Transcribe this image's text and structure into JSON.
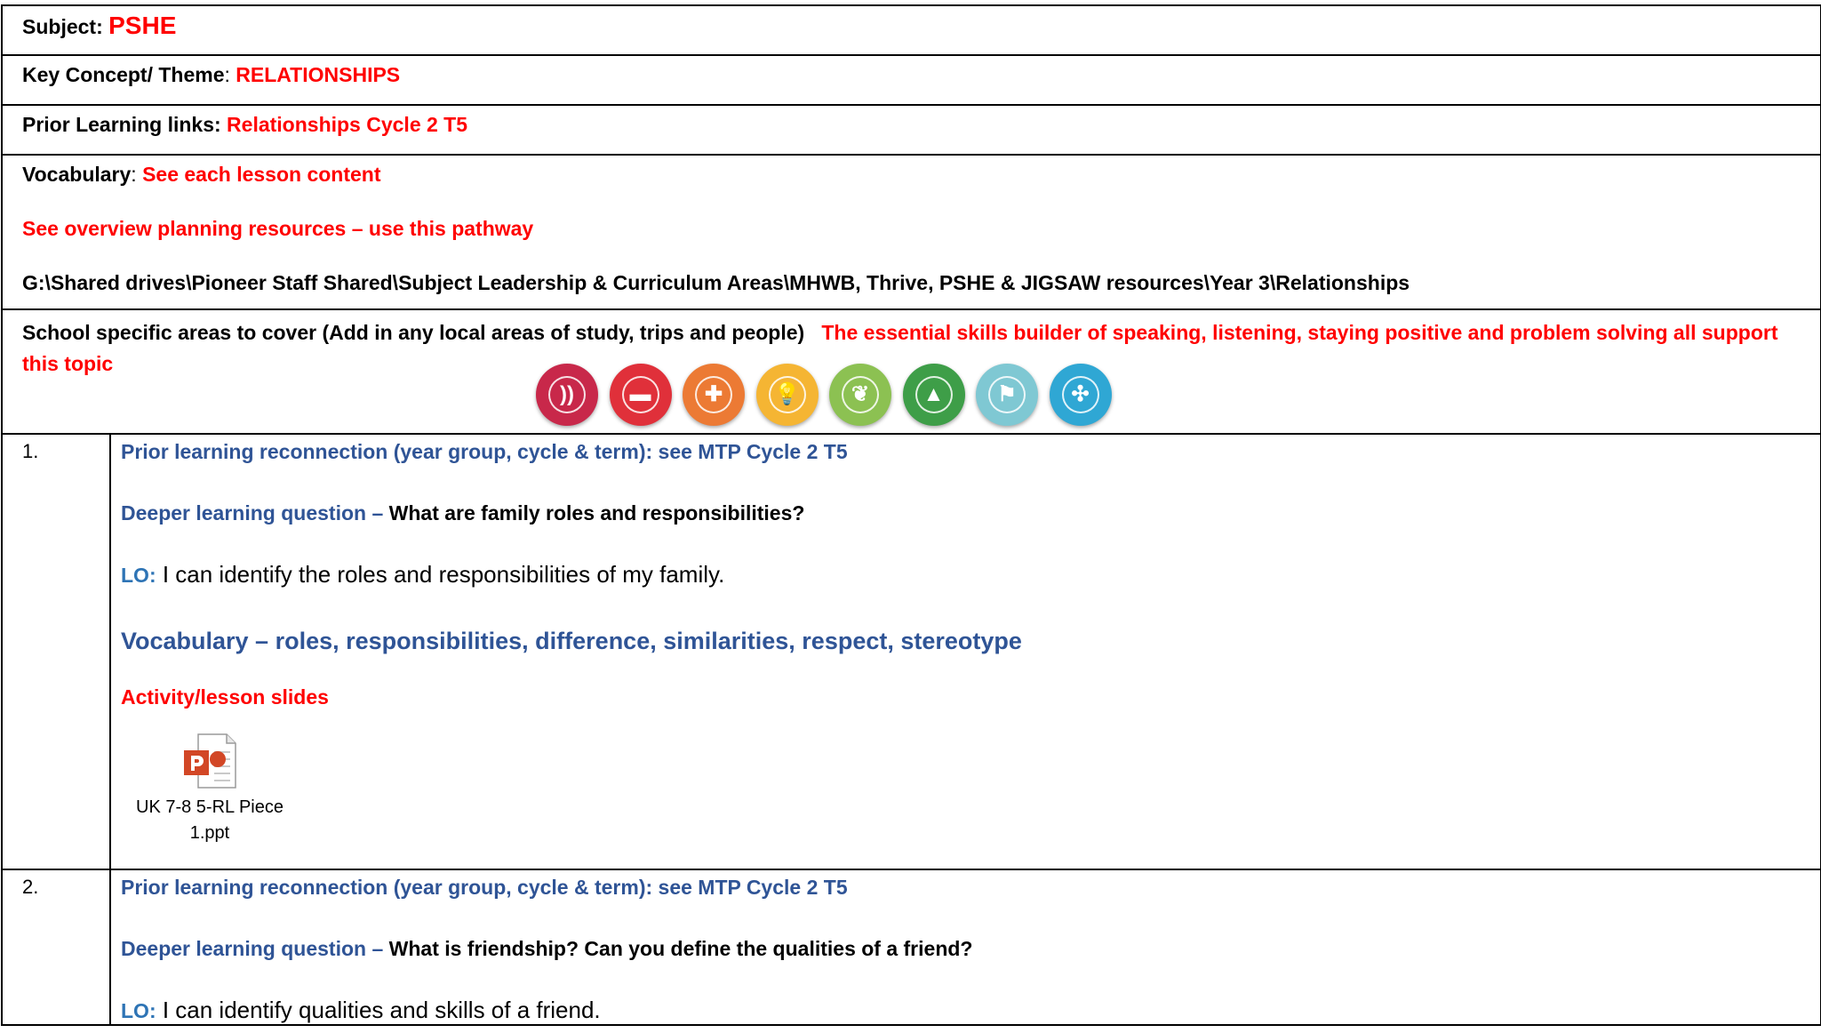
{
  "header": {
    "subject_label": "Subject:",
    "subject_value": "PSHE",
    "theme_label": "Key Concept/ Theme",
    "theme_sep": ":",
    "theme_value": "RELATIONSHIPS",
    "prior_label": "Prior Learning links:",
    "prior_value": "Relationships Cycle 2 T5",
    "vocab_label": "Vocabulary",
    "vocab_sep": ":",
    "vocab_value": "See each lesson content",
    "overview_text": "See overview planning resources – use this pathway",
    "path_text": "G:\\Shared drives\\Pioneer Staff Shared\\Subject Leadership & Curriculum Areas\\MHWB, Thrive, PSHE & JIGSAW resources\\Year 3\\Relationships",
    "school_label": "School specific areas to cover (Add in any local areas of study, trips and people)",
    "school_value": "The essential skills builder of speaking, listening, staying positive and problem solving all support this topic"
  },
  "skills_icons": [
    {
      "name": "listening-icon",
      "label": "LISTENING",
      "color": "#c8284a"
    },
    {
      "name": "speaking-icon",
      "label": "SPEAKING",
      "color": "#e0303a"
    },
    {
      "name": "problem-solving-icon",
      "label": "PROBLEM SOLVING",
      "color": "#ec7a34"
    },
    {
      "name": "creativity-icon",
      "label": "CREATIVITY",
      "color": "#f5b533"
    },
    {
      "name": "staying-positive-icon",
      "label": "STAYING POSITIVE",
      "color": "#8cc152"
    },
    {
      "name": "aiming-high-icon",
      "label": "AIMING HIGH",
      "color": "#3e9e48"
    },
    {
      "name": "leadership-icon",
      "label": "LEADERSHIP",
      "color": "#7fc8d3"
    },
    {
      "name": "teamwork-icon",
      "label": "TEAMWORK",
      "color": "#2fa7d4"
    }
  ],
  "lessons": [
    {
      "number": "1.",
      "prior_label": "Prior learning reconnection (year group, cycle & term):  see MTP Cycle 2 T5",
      "deeper_label": "Deeper learning question –",
      "deeper_text": " What are family roles and responsibilities?",
      "lo_label": "LO:",
      "lo_text": " I can identify the roles and responsibilities of my family.",
      "vocab": "Vocabulary – roles, responsibilities, difference, similarities, respect, stereotype",
      "activity": "Activity/lesson slides",
      "file_line1": "UK 7-8 5-RL Piece",
      "file_line2": "1.ppt"
    },
    {
      "number": "2.",
      "prior_label": "Prior learning reconnection (year group, cycle & term):  see MTP Cycle 2 T5",
      "deeper_label": "Deeper learning question –",
      "deeper_text": " What is friendship? Can you define the qualities of a friend?",
      "lo_label": "LO:",
      "lo_text": " I can identify qualities and skills of a friend."
    }
  ]
}
